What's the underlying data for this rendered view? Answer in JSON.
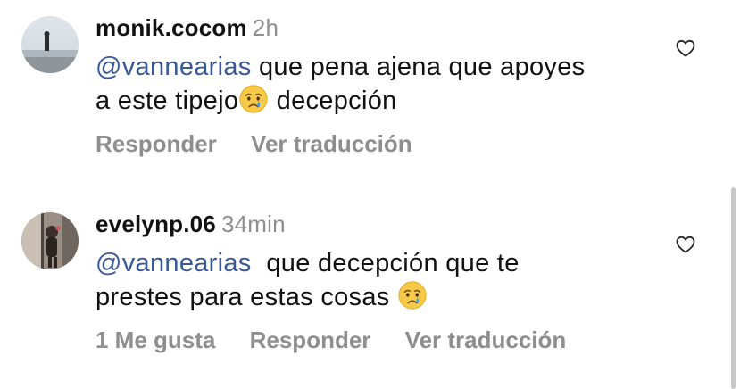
{
  "comments": [
    {
      "username": "monik.cocom",
      "time": "2h",
      "mention": "@vannearias",
      "text_line1": " que pena ajena que apoyes",
      "text_line2a": "a este tipejo",
      "text_line2b": " decepción",
      "actions": [
        "Responder",
        "Ver traducción"
      ],
      "avatar_icon": "beach-person-avatar",
      "emoji": "crying-face"
    },
    {
      "username": "evelynp.06",
      "time": "34min",
      "mention": "@vannearias",
      "text_line1": "  que decepción que te",
      "text_line2": "prestes para estas cosas ",
      "actions": [
        "1 Me gusta",
        "Responder",
        "Ver traducción"
      ],
      "avatar_icon": "mirror-selfie-avatar",
      "emoji": "crying-face"
    }
  ],
  "icons": {
    "like": "heart-outline-icon"
  },
  "colors": {
    "mention": "#385898",
    "secondary_text": "#8e8e8e",
    "primary_text": "#111111"
  }
}
